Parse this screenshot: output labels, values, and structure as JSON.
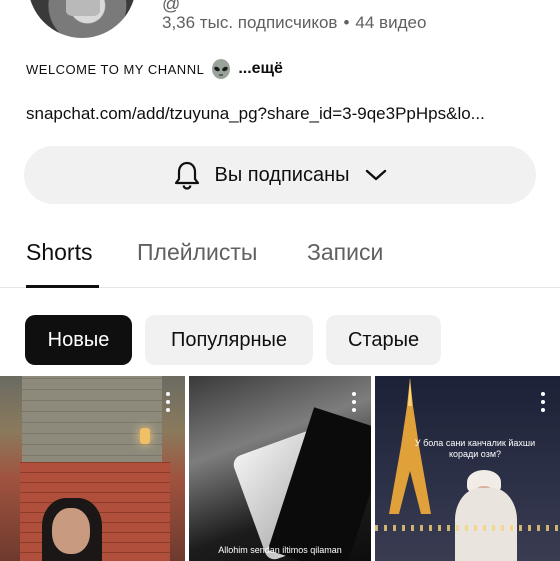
{
  "channel": {
    "handle_fragment": "@",
    "subscribers": "3,36 тыс. подписчиков",
    "separator": "•",
    "videos": "44 видео",
    "description": "WELCOME TO MY CHANNL",
    "description_emoji": "alien-icon",
    "more_label": "...ещё",
    "link": "snapchat.com/add/tzuyuna_pg?share_id=3-9qe3PpHps&lo..."
  },
  "subscribe": {
    "label": "Вы подписаны",
    "icon": "bell-icon",
    "dropdown_icon": "chevron-down-icon"
  },
  "tabs": [
    {
      "label": "Shorts",
      "active": true
    },
    {
      "label": "Плейлисты",
      "active": false
    },
    {
      "label": "Записи",
      "active": false
    }
  ],
  "filters": [
    {
      "label": "Новые",
      "active": true
    },
    {
      "label": "Популярные",
      "active": false
    },
    {
      "label": "Старые",
      "active": false
    }
  ],
  "shorts": [
    {
      "caption": "",
      "overlay_text": ""
    },
    {
      "caption": "Allohim sendan iltimos qilaman",
      "overlay_text": ""
    },
    {
      "caption": "У бола сани канчалик йахши коради озм?",
      "overlay_text": ""
    }
  ],
  "colors": {
    "text_primary": "#0f0f0f",
    "text_secondary": "#606060",
    "chip_bg": "#f1f1f1",
    "chip_active_bg": "#0f0f0f"
  }
}
